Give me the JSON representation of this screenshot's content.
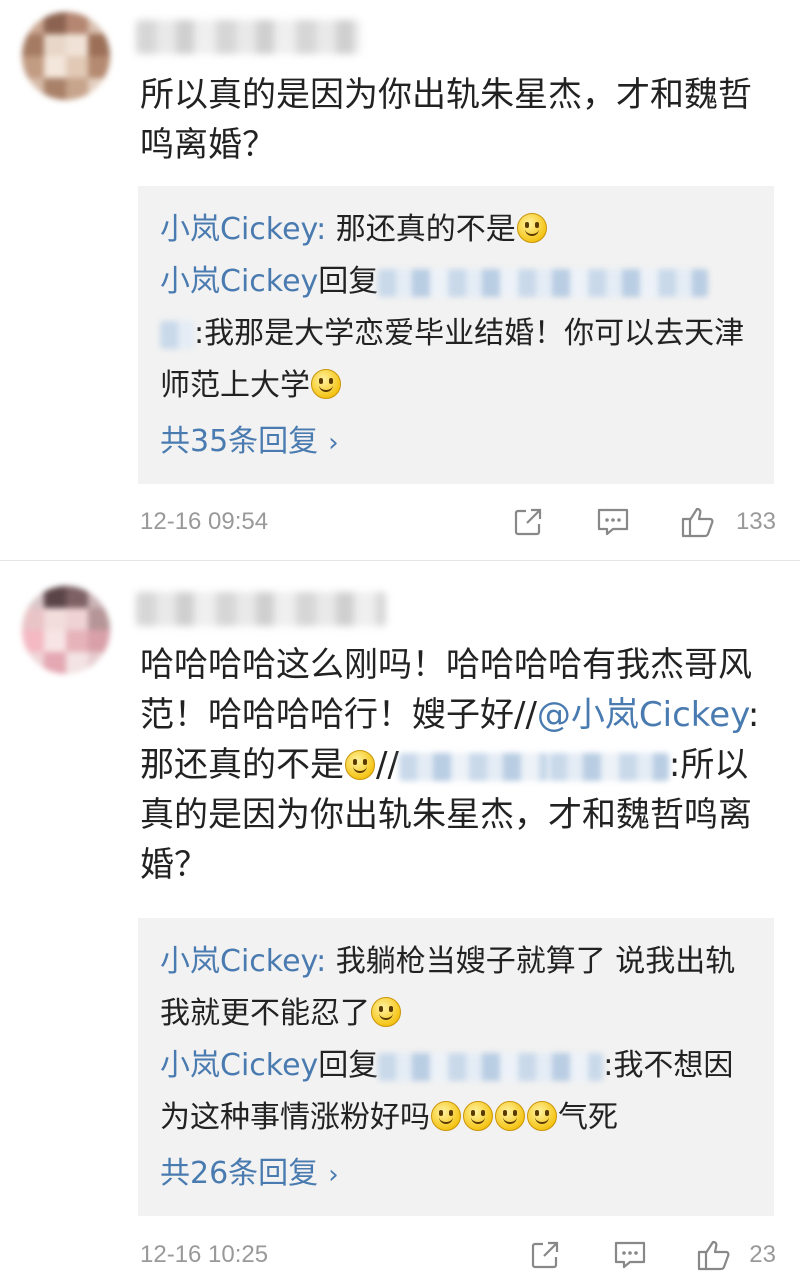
{
  "comments": [
    {
      "text": "所以真的是因为你出轨朱星杰，才和魏哲鸣离婚？",
      "replies": [
        {
          "user": "小岚Cickey",
          "sep": ": ",
          "text": "那还真的不是",
          "emoji": 1
        },
        {
          "user": "小岚Cickey",
          "reply_word": "回复",
          "text": ":我那是大学恋爱毕业结婚！你可以去天津师范上大学",
          "emoji": 1
        }
      ],
      "more": "共35条回复",
      "time": "12-16 09:54",
      "likes": "133"
    },
    {
      "text_part1": "哈哈哈哈这么刚吗！哈哈哈哈有我杰哥风范！哈哈哈哈行！嫂子好//",
      "mention": "@小岚Cickey",
      "text_part2": ":那还真的不是",
      "text_part3": "//",
      "text_part4": ":所以真的是因为你出轨朱星杰，才和魏哲鸣离婚？",
      "replies": [
        {
          "user": "小岚Cickey",
          "sep": ": ",
          "text": "我躺枪当嫂子就算了 说我出轨我就更不能忍了",
          "emoji": 1
        },
        {
          "user": "小岚Cickey",
          "reply_word": "回复",
          "text": ":我不想因为这种事情涨粉好吗",
          "emoji": 4,
          "tail": "气死"
        }
      ],
      "more": "共26条回复",
      "time": "12-16 10:25",
      "likes": "23"
    }
  ],
  "more_chevron": "›",
  "icons": [
    "share-icon",
    "comment-icon",
    "like-icon"
  ],
  "colors": {
    "link": "#4a7bb0",
    "meta": "#999999",
    "reply_bg": "#f2f2f2"
  }
}
